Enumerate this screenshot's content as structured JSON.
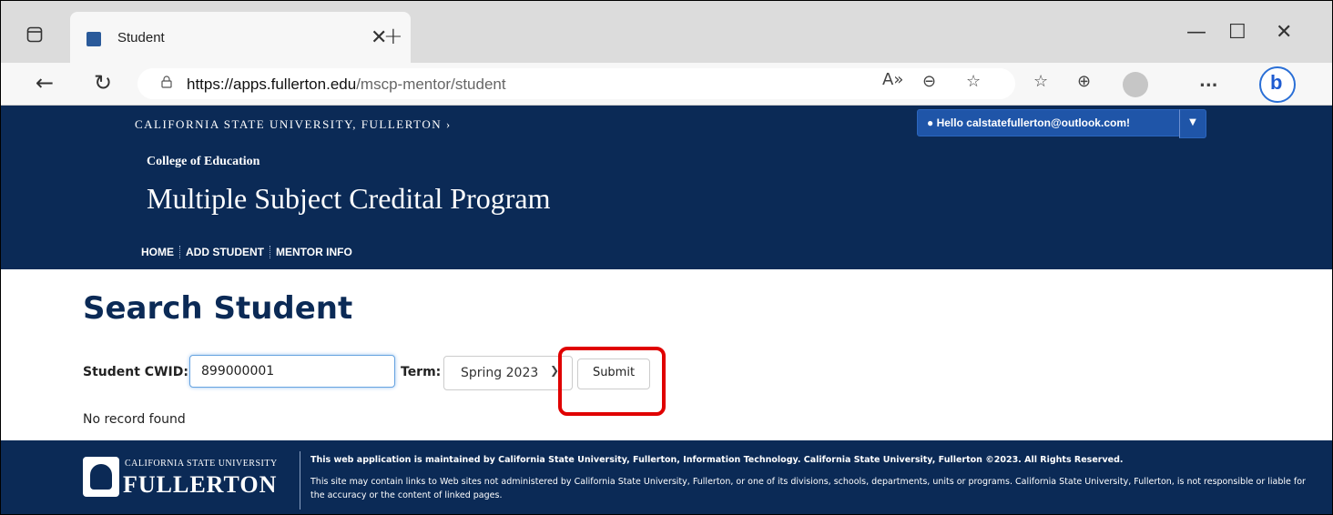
{
  "browser": {
    "tab_title": "Student",
    "url_host": "https://apps.fullerton.edu",
    "url_path": "/mscp-mentor/student",
    "menu_label": "..."
  },
  "site": {
    "university": "CALIFORNIA STATE UNIVERSITY, FULLERTON ›",
    "user_greeting": "Hello calstatefullerton@outlook.com!",
    "college": "College of Education",
    "program": "Multiple Subject Credital Program",
    "nav": [
      "HOME",
      "ADD STUDENT",
      "MENTOR INFO"
    ]
  },
  "main": {
    "title": "Search Student",
    "cwid_label": "Student CWID:",
    "cwid_value": "899000001",
    "term_label": "Term:",
    "term_value": "Spring 2023",
    "submit_label": "Submit",
    "status": "No record found"
  },
  "footer": {
    "logo_small": "CALIFORNIA STATE UNIVERSITY",
    "logo_big": "FULLERTON",
    "line1": "This web application is maintained by California State University, Fullerton, Information Technology. California State University, Fullerton ©2023. All Rights Reserved.",
    "line2": "This site may contain links to Web sites not administered by California State University, Fullerton, or one of its divisions, schools, departments, units or programs. California State University, Fullerton, is not responsible or liable for the accuracy or the content of linked pages."
  },
  "colors": {
    "brand_navy": "#0b2a56",
    "highlight_red": "#e00000",
    "button_blue": "#1f55a8"
  }
}
